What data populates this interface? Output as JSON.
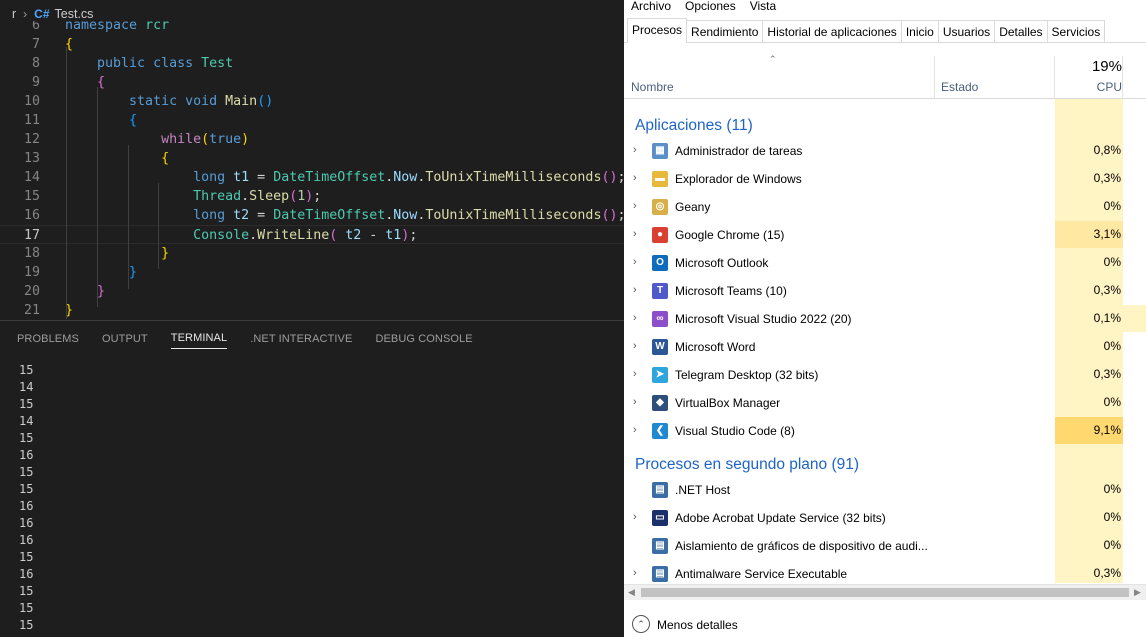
{
  "vscode": {
    "breadcrumb": {
      "folder": "r",
      "file_icon": "C#",
      "file": "Test.cs"
    },
    "code_lines": [
      {
        "n": "6",
        "html": "<span class='kw'>namespace</span> <span class='ns'>rcr</span>"
      },
      {
        "n": "7",
        "html": "<span class='b1'>{</span>"
      },
      {
        "n": "8",
        "html": "    <span class='kw'>public</span> <span class='kw'>class</span> <span class='ty'>Test</span>"
      },
      {
        "n": "9",
        "html": "    <span class='b2'>{</span>"
      },
      {
        "n": "10",
        "html": "        <span class='kw'>static</span> <span class='kw'>void</span> <span class='fn'>Main</span><span class='b3'>()</span>"
      },
      {
        "n": "11",
        "html": "        <span class='b3'>{</span>"
      },
      {
        "n": "12",
        "html": "            <span class='ctl'>while</span><span class='b1'>(</span><span class='kw'>true</span><span class='b1'>)</span>"
      },
      {
        "n": "13",
        "html": "            <span class='b1'>{</span>"
      },
      {
        "n": "14",
        "html": "                <span class='kw'>long</span> <span class='va'>t1</span> = <span class='ty'>DateTimeOffset</span>.<span class='va'>Now</span>.<span class='fn'>ToUnixTimeMilliseconds</span><span class='b2'>()</span>;"
      },
      {
        "n": "15",
        "html": "                <span class='ty'>Thread</span>.<span class='fn'>Sleep</span><span class='b2'>(</span><span class='nu'>1</span><span class='b2'>)</span>;"
      },
      {
        "n": "16",
        "html": "                <span class='kw'>long</span> <span class='va'>t2</span> = <span class='ty'>DateTimeOffset</span>.<span class='va'>Now</span>.<span class='fn'>ToUnixTimeMilliseconds</span><span class='b2'>()</span>;"
      },
      {
        "n": "17",
        "html": "                <span class='ty'>Console</span>.<span class='fn'>WriteLine</span><span class='b2'>(</span> <span class='va'>t2</span> - <span class='va'>t1</span><span class='b2'>)</span>;"
      },
      {
        "n": "18",
        "html": "            <span class='b1'>}</span>"
      },
      {
        "n": "19",
        "html": "        <span class='b3'>}</span>"
      },
      {
        "n": "20",
        "html": "    <span class='b2'>}</span>"
      },
      {
        "n": "21",
        "html": "<span class='b1'>}</span>"
      }
    ],
    "panel_tabs": [
      "PROBLEMS",
      "OUTPUT",
      "TERMINAL",
      ".NET INTERACTIVE",
      "DEBUG CONSOLE"
    ],
    "active_panel_tab": "TERMINAL",
    "terminal_lines": [
      "15",
      "14",
      "15",
      "14",
      "15",
      "16",
      "15",
      "15",
      "16",
      "16",
      "16",
      "15",
      "16",
      "15",
      "15",
      "15"
    ]
  },
  "taskmgr": {
    "menu": [
      "Archivo",
      "Opciones",
      "Vista"
    ],
    "tabs": [
      "Procesos",
      "Rendimiento",
      "Historial de aplicaciones",
      "Inicio",
      "Usuarios",
      "Detalles",
      "Servicios"
    ],
    "active_tab": "Procesos",
    "header": {
      "name": "Nombre",
      "state": "Estado",
      "cpu_total": "19%",
      "cpu": "CPU"
    },
    "groups": [
      {
        "title": "Aplicaciones (11)",
        "items": [
          {
            "name": "Administrador de tareas",
            "cpu": "0,8%",
            "icon": "taskmgr-icon",
            "color": "#5a8fc8",
            "glyph": "▦",
            "chevron": true
          },
          {
            "name": "Explorador de Windows",
            "cpu": "0,3%",
            "icon": "folder-icon",
            "color": "#e8b83a",
            "glyph": "▬",
            "chevron": true
          },
          {
            "name": "Geany",
            "cpu": "0%",
            "icon": "geany-icon",
            "color": "#d8b04a",
            "glyph": "◎",
            "chevron": true
          },
          {
            "name": "Google Chrome (15)",
            "cpu": "3,1%",
            "icon": "chrome-icon",
            "color": "#d94032",
            "glyph": "●",
            "chevron": true,
            "hi": 1
          },
          {
            "name": "Microsoft Outlook",
            "cpu": "0%",
            "icon": "outlook-icon",
            "color": "#0f6cbd",
            "glyph": "O",
            "chevron": true
          },
          {
            "name": "Microsoft Teams (10)",
            "cpu": "0,3%",
            "icon": "teams-icon",
            "color": "#5059c9",
            "glyph": "T",
            "chevron": true
          },
          {
            "name": "Microsoft Visual Studio 2022 (20)",
            "cpu": "0,1%",
            "icon": "visual-studio-icon",
            "color": "#8d4fc9",
            "glyph": "∞",
            "chevron": true,
            "warm_edge": true
          },
          {
            "name": "Microsoft Word",
            "cpu": "0%",
            "icon": "word-icon",
            "color": "#2b5797",
            "glyph": "W",
            "chevron": true
          },
          {
            "name": "Telegram Desktop (32 bits)",
            "cpu": "0,3%",
            "icon": "telegram-icon",
            "color": "#2ea6dc",
            "glyph": "➤",
            "chevron": true
          },
          {
            "name": "VirtualBox Manager",
            "cpu": "0%",
            "icon": "virtualbox-icon",
            "color": "#2c4f7c",
            "glyph": "◆",
            "chevron": true
          },
          {
            "name": "Visual Studio Code (8)",
            "cpu": "9,1%",
            "icon": "vscode-icon",
            "color": "#1f8ad2",
            "glyph": "❮",
            "chevron": true,
            "hi": 2
          }
        ]
      },
      {
        "title": "Procesos en segundo plano (91)",
        "items": [
          {
            "name": ".NET Host",
            "cpu": "0%",
            "icon": "app-window-icon",
            "color": "#3b6ea5",
            "glyph": "▤",
            "chevron": false
          },
          {
            "name": "Adobe Acrobat Update Service (32 bits)",
            "cpu": "0%",
            "icon": "service-window-icon",
            "color": "#1a2f6b",
            "glyph": "▭",
            "chevron": true
          },
          {
            "name": "Aislamiento de gráficos de dispositivo de audi...",
            "cpu": "0%",
            "icon": "app-window-icon",
            "color": "#3b6ea5",
            "glyph": "▤",
            "chevron": false
          },
          {
            "name": "Antimalware Service Executable",
            "cpu": "0,3%",
            "icon": "app-window-icon",
            "color": "#3b6ea5",
            "glyph": "▤",
            "chevron": true
          }
        ]
      }
    ],
    "footer": {
      "label": "Menos detalles",
      "arrow": "⌃"
    }
  }
}
